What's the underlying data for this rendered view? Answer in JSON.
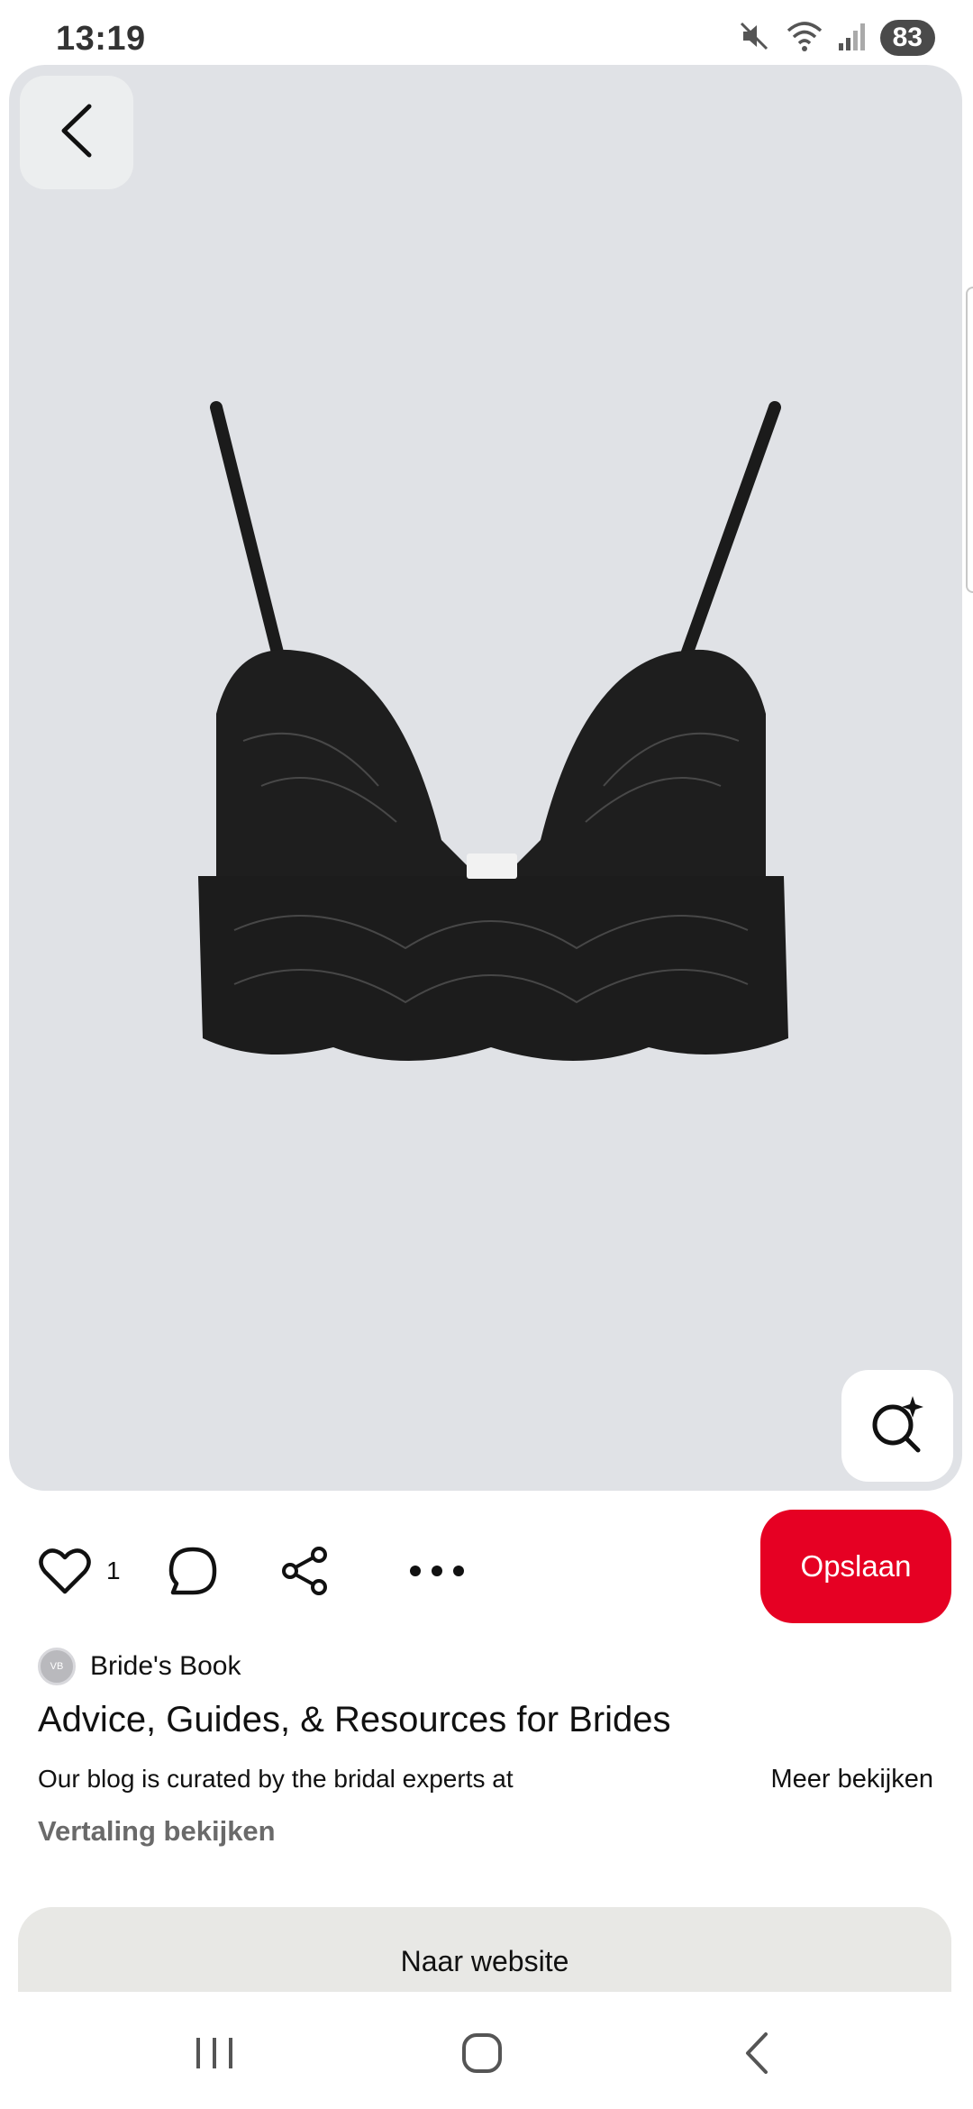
{
  "status_bar": {
    "time": "13:19",
    "battery": "83",
    "icons": [
      "mute-icon",
      "wifi-icon",
      "signal-icon"
    ]
  },
  "pin": {
    "image_alt": "Black lace bralette",
    "icons": [
      "back-arrow-icon",
      "visual-search-icon"
    ]
  },
  "actions": {
    "like_count": "1",
    "icons": [
      "heart-icon",
      "comment-icon",
      "share-icon",
      "more-icon"
    ],
    "save_label": "Opslaan",
    "save_color": "#e60023"
  },
  "creator": {
    "name": "Bride's Book"
  },
  "details": {
    "title": "Advice, Guides, & Resources for Brides",
    "description": "Our blog is curated by the bridal experts at",
    "more_label": "Meer bekijken",
    "translate_label": "Vertaling bekijken"
  },
  "website_button": {
    "label": "Naar website"
  },
  "nav": {
    "icons": [
      "recents-icon",
      "home-icon",
      "back-icon"
    ]
  }
}
